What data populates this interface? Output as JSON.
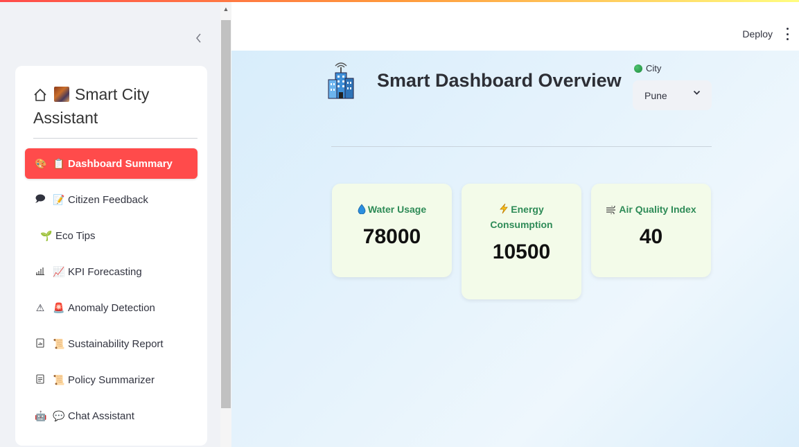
{
  "sidebar": {
    "brand": {
      "line1": "Smart City",
      "line2": "Assistant"
    },
    "items": [
      {
        "label": "Dashboard Summary",
        "icon1": "palette-icon",
        "icon2": "clipboard-icon",
        "g1": "🎨",
        "g2": "📋",
        "active": true
      },
      {
        "label": "Citizen Feedback",
        "icon1": "message-square-icon",
        "icon2": "memo-icon",
        "g1": "🗩",
        "g2": "📝"
      },
      {
        "label": "Eco Tips",
        "icon1": "",
        "icon2": "seedling-icon",
        "g1": "",
        "g2": "🌱"
      },
      {
        "label": "KPI Forecasting",
        "icon1": "bar-chart-icon",
        "icon2": "chart-increasing-icon",
        "g1": "📶",
        "g2": "📈"
      },
      {
        "label": "Anomaly Detection",
        "icon1": "warning-icon",
        "icon2": "siren-icon",
        "g1": "⚠",
        "g2": "🚨"
      },
      {
        "label": "Sustainability Report",
        "icon1": "report-icon",
        "icon2": "scroll-icon",
        "g1": "📊",
        "g2": "📜"
      },
      {
        "label": "Policy Summarizer",
        "icon1": "document-icon",
        "icon2": "scroll-icon",
        "g1": "📄",
        "g2": "📜"
      },
      {
        "label": "Chat Assistant",
        "icon1": "robot-icon",
        "icon2": "speech-bubble-icon",
        "g1": "🤖",
        "g2": "💬"
      }
    ]
  },
  "header": {
    "deploy_label": "Deploy"
  },
  "main": {
    "title": "Smart Dashboard Overview",
    "city_label": "City",
    "city_value": "Pune",
    "metrics": [
      {
        "label": "Water Usage",
        "value": "78000",
        "icon": "droplet-icon"
      },
      {
        "label": "Energy Consumption",
        "value": "10500",
        "icon": "lightning-icon"
      },
      {
        "label": "Air Quality Index",
        "value": "40",
        "icon": "wind-icon"
      }
    ]
  },
  "colors": {
    "accent": "#ff4b4b",
    "metric_label": "#2e8b57",
    "metric_card": "#f3fbe9",
    "main_bg": "#e3f2fc"
  }
}
